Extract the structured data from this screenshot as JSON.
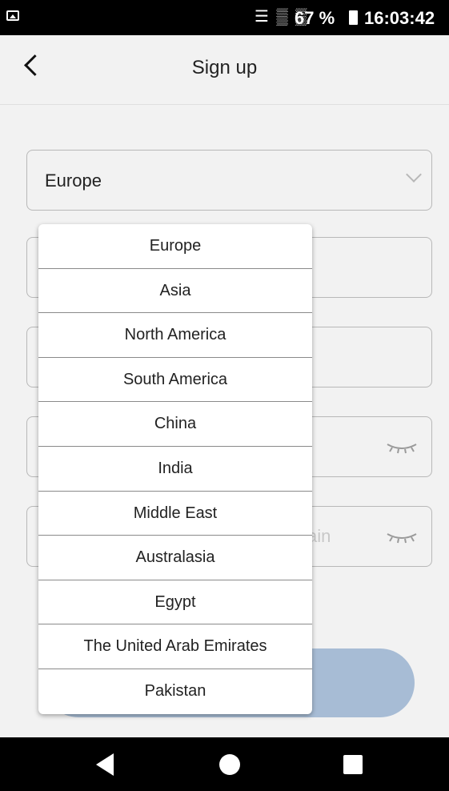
{
  "status_bar": {
    "icons": "☰ ▒ ▒",
    "battery": "67 %",
    "time": "16:03:42"
  },
  "header": {
    "title": "Sign up"
  },
  "region_select": {
    "value": "Europe"
  },
  "fields": {
    "confirm_password_partial_placeholder": "ain"
  },
  "dropdown": {
    "options": [
      "Europe",
      "Asia",
      "North America",
      "South America",
      "China",
      "India",
      "Middle East",
      "Australasia",
      "Egypt",
      "The United Arab Emirates",
      "Pakistan"
    ]
  },
  "colors": {
    "background": "#f2f2f2",
    "button": "#a7bcd5",
    "system_bars": "#000000"
  }
}
